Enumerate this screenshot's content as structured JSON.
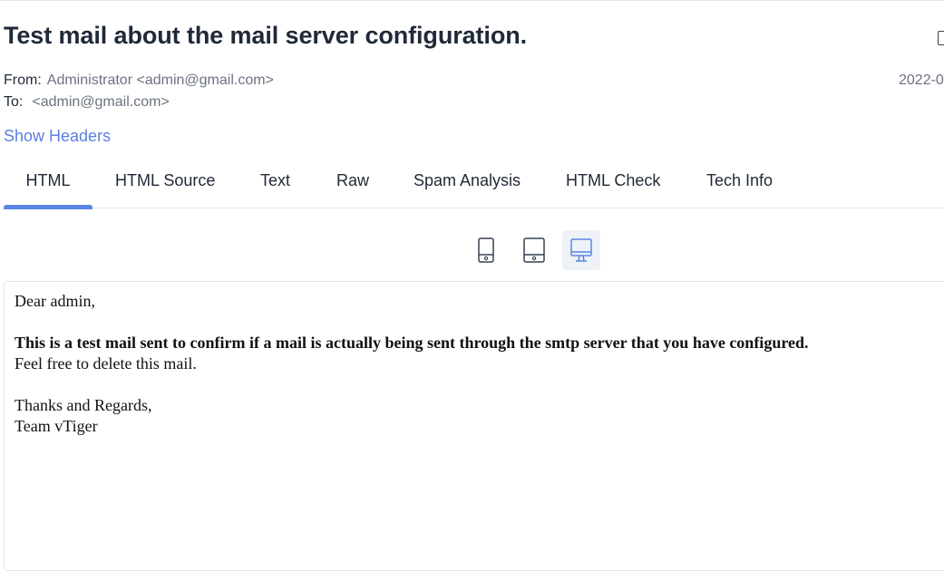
{
  "email": {
    "subject": "Test mail about the mail server configuration.",
    "from_label": "From:",
    "from_value": "Administrator <admin@gmail.com>",
    "to_label": "To:",
    "to_value": "<admin@gmail.com>",
    "date": "2022-0",
    "show_headers": "Show Headers"
  },
  "tabs": [
    {
      "label": "HTML",
      "active": true
    },
    {
      "label": "HTML Source",
      "active": false
    },
    {
      "label": "Text",
      "active": false
    },
    {
      "label": "Raw",
      "active": false
    },
    {
      "label": "Spam Analysis",
      "active": false
    },
    {
      "label": "HTML Check",
      "active": false
    },
    {
      "label": "Tech Info",
      "active": false
    }
  ],
  "device_toggle": {
    "options": [
      {
        "icon": "mobile-icon",
        "selected": false
      },
      {
        "icon": "tablet-icon",
        "selected": false
      },
      {
        "icon": "desktop-icon",
        "selected": true
      }
    ],
    "accent": "#5b84e6"
  },
  "body": {
    "greeting": "Dear admin,",
    "bold_line": "This is a test mail sent to confirm if a mail is actually being sent through the smtp server that you have configured.",
    "line2": "Feel free to delete this mail.",
    "closing": "Thanks and Regards,",
    "signature": "Team vTiger"
  }
}
